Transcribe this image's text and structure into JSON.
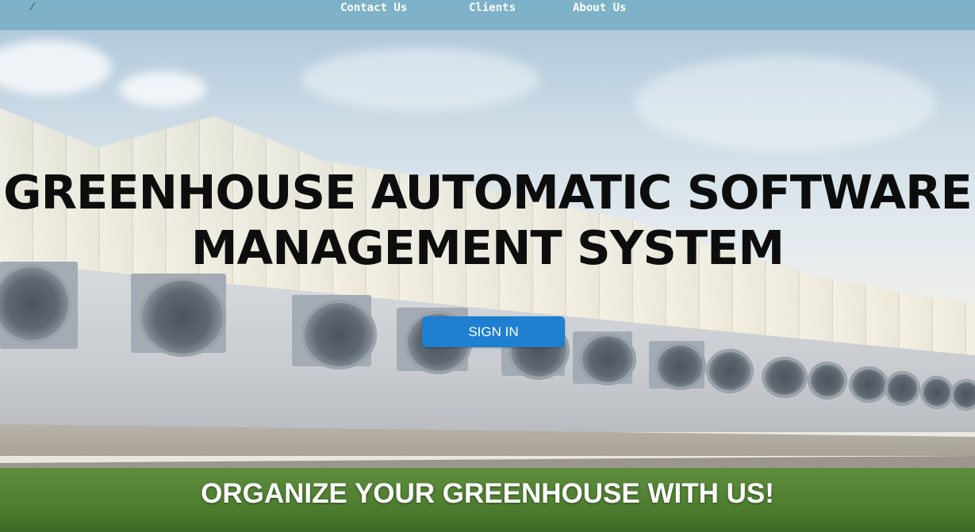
{
  "nav": {
    "links": [
      {
        "label": "Contact Us"
      },
      {
        "label": "Clients"
      },
      {
        "label": "About Us"
      }
    ]
  },
  "hero": {
    "title_line1": "GREENHOUSE AUTOMATIC SOFTWARE",
    "title_line2": "MANAGEMENT SYSTEM",
    "signin_label": "SIGN IN",
    "tagline": "ORGANIZE YOUR GREENHOUSE WITH US!"
  },
  "colors": {
    "navbar": "#78b0c8",
    "button": "#1f7fd0",
    "title_text": "#0d0d0d",
    "tagline_text": "#ffffff"
  },
  "background": {
    "icon": "greenhouse-photo"
  }
}
